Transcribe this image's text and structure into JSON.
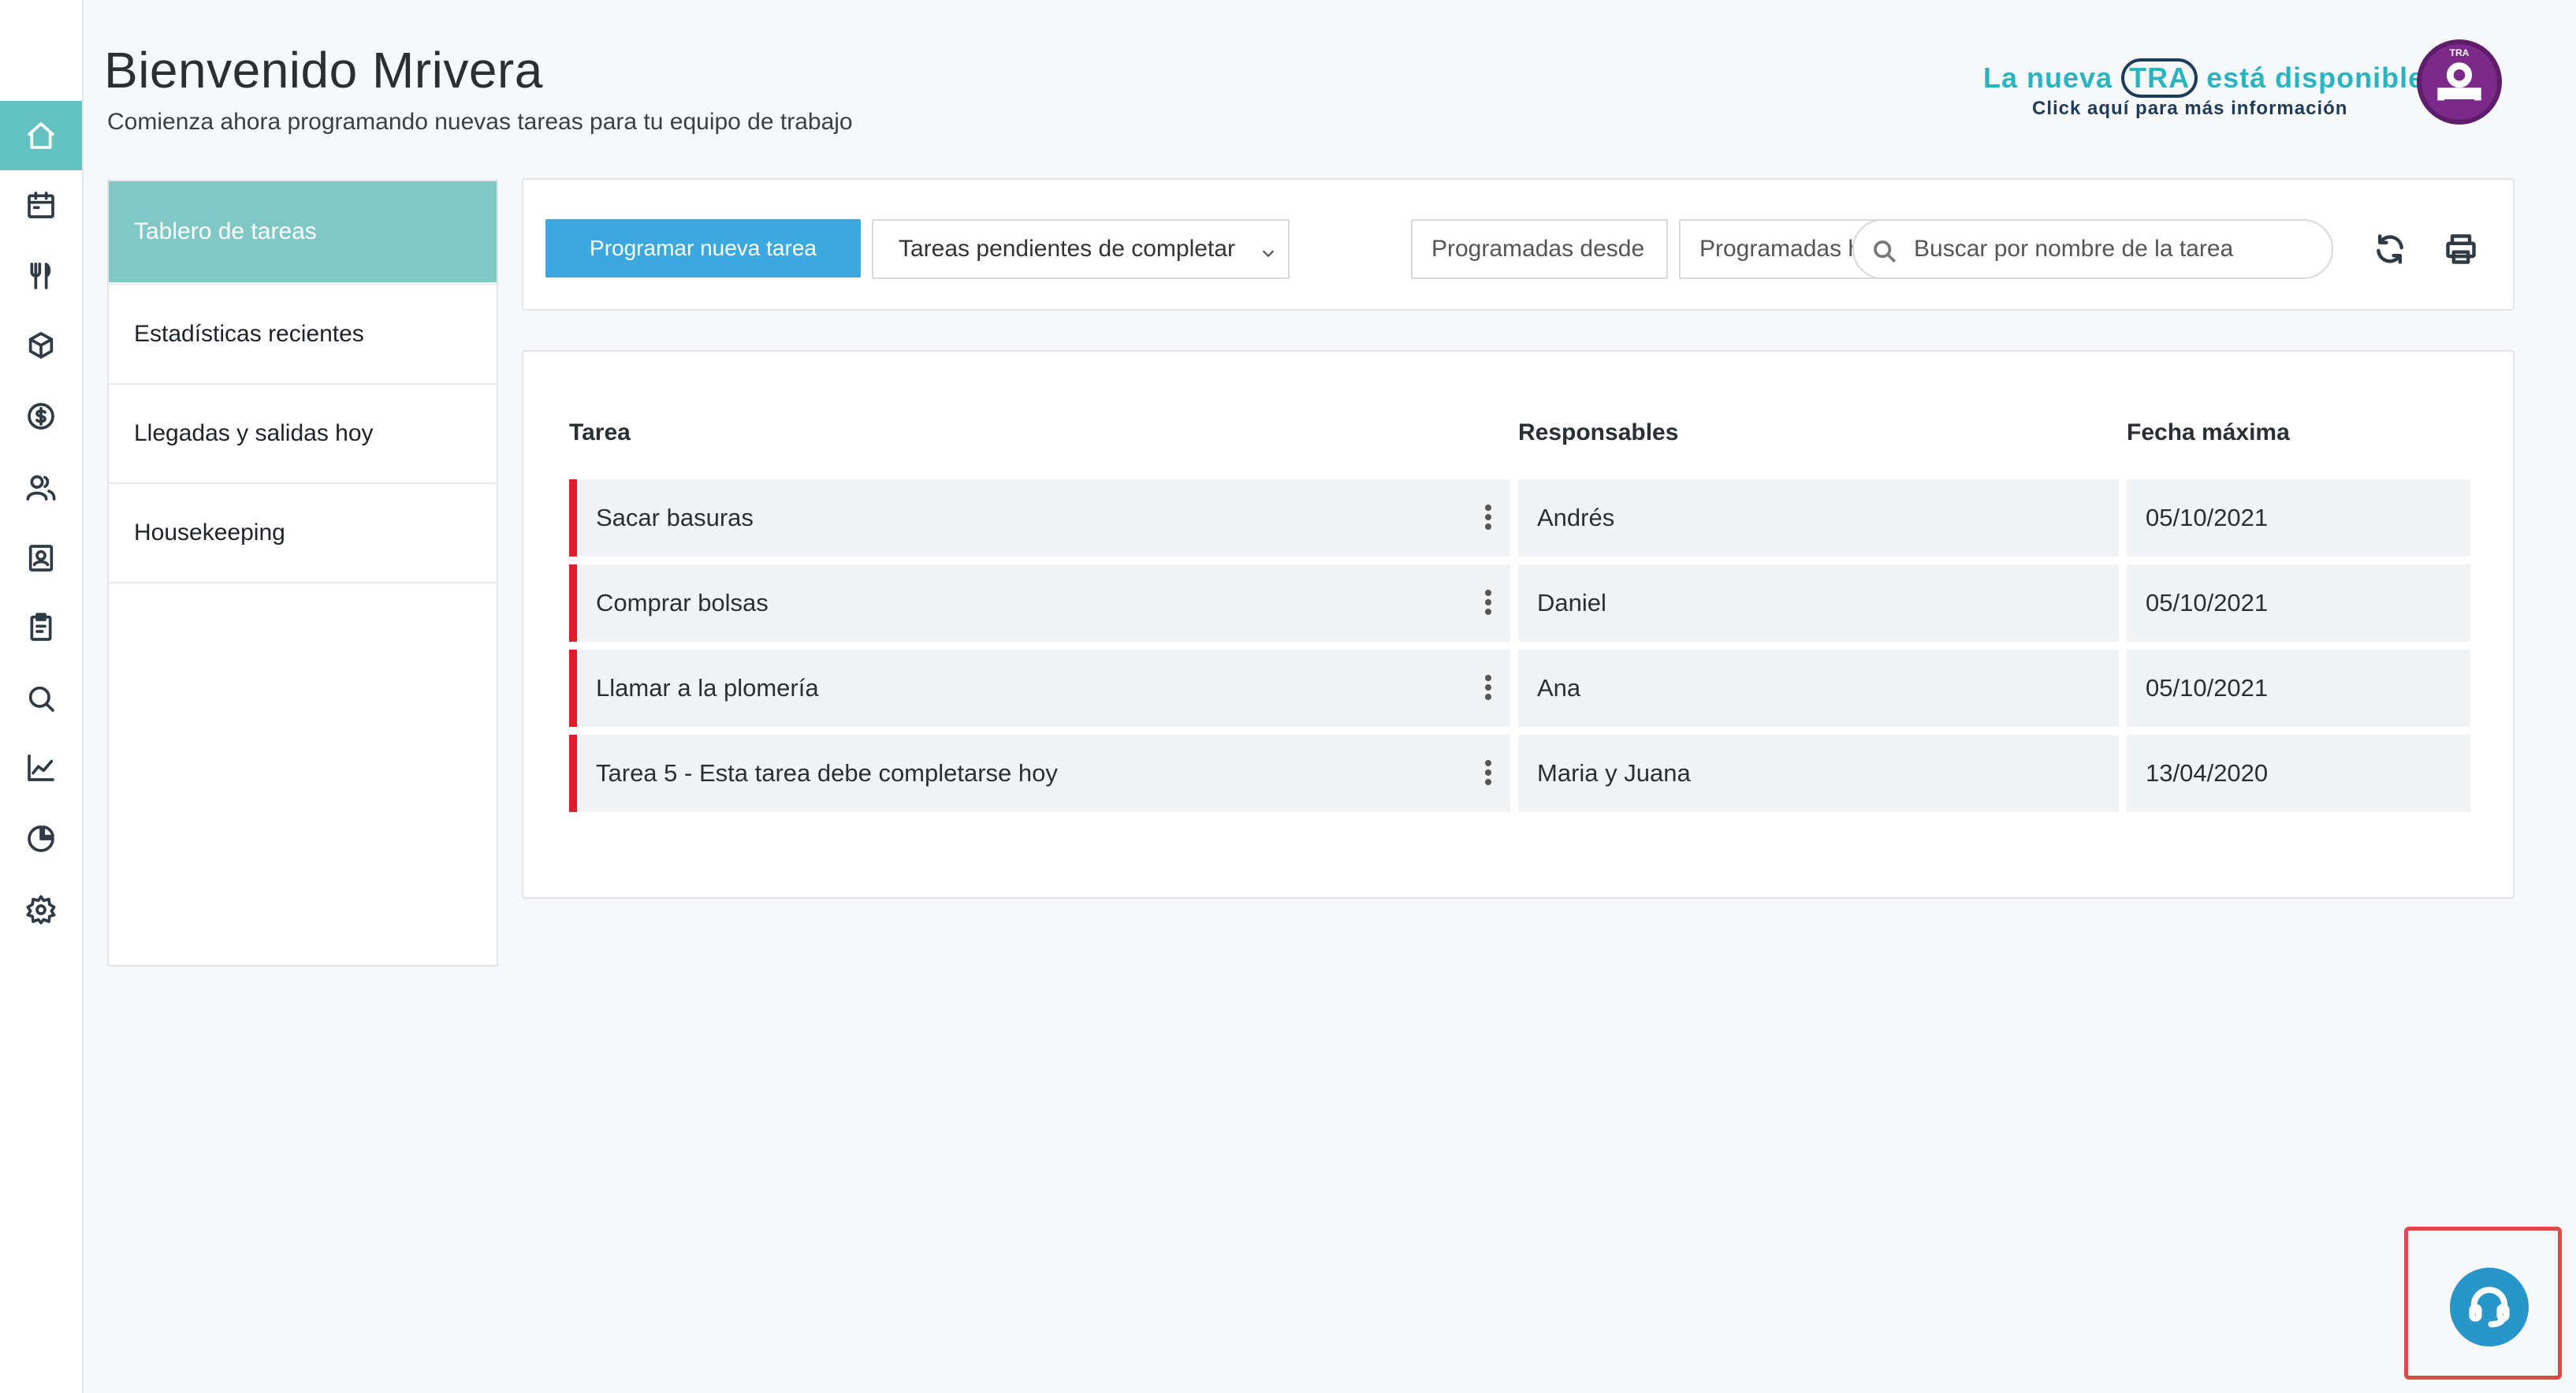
{
  "header": {
    "title": "Bienvenido Mrivera",
    "subtitle": "Comienza ahora programando nuevas tareas para tu equipo de trabajo"
  },
  "promo": {
    "line1_before": "La nueva",
    "line1_tra": "TRA",
    "line1_after": "está disponible",
    "line2": "Click aquí para más información",
    "badge_text": "TRA"
  },
  "rail": {
    "items": [
      {
        "icon": "home-icon",
        "active": true
      },
      {
        "icon": "calendar-icon"
      },
      {
        "icon": "restaurant-icon"
      },
      {
        "icon": "box-icon"
      },
      {
        "icon": "dollar-icon"
      },
      {
        "icon": "users-icon"
      },
      {
        "icon": "contact-book-icon"
      },
      {
        "icon": "clipboard-icon"
      },
      {
        "icon": "search-icon"
      },
      {
        "icon": "line-chart-icon"
      },
      {
        "icon": "pie-chart-icon"
      },
      {
        "icon": "settings-icon"
      }
    ]
  },
  "sidebar": {
    "items": [
      {
        "label": "Tablero de tareas",
        "active": true
      },
      {
        "label": "Estadísticas recientes"
      },
      {
        "label": "Llegadas y salidas hoy"
      },
      {
        "label": "Housekeeping"
      }
    ]
  },
  "toolbar": {
    "new_task_label": "Programar nueva tarea",
    "filter_selected": "Tareas pendientes de completar",
    "from_placeholder": "Programadas desde",
    "to_placeholder": "Programadas hasta",
    "search_placeholder": "Buscar por nombre de la tarea"
  },
  "table": {
    "headers": {
      "task": "Tarea",
      "responsible": "Responsables",
      "due": "Fecha máxima"
    },
    "rows": [
      {
        "task": "Sacar basuras",
        "responsible": "Andrés",
        "due": "05/10/2021"
      },
      {
        "task": "Comprar bolsas",
        "responsible": "Daniel",
        "due": "05/10/2021"
      },
      {
        "task": "Llamar a la plomería",
        "responsible": "Ana",
        "due": "05/10/2021"
      },
      {
        "task": "Tarea 5 - Esta tarea debe completarse hoy",
        "responsible": "Maria y Juana",
        "due": "13/04/2020"
      }
    ]
  },
  "colors": {
    "accent": "#63c2c0",
    "primary_button": "#3da8df",
    "overdue_marker": "#e01e2b",
    "help_button": "#2896c8"
  }
}
